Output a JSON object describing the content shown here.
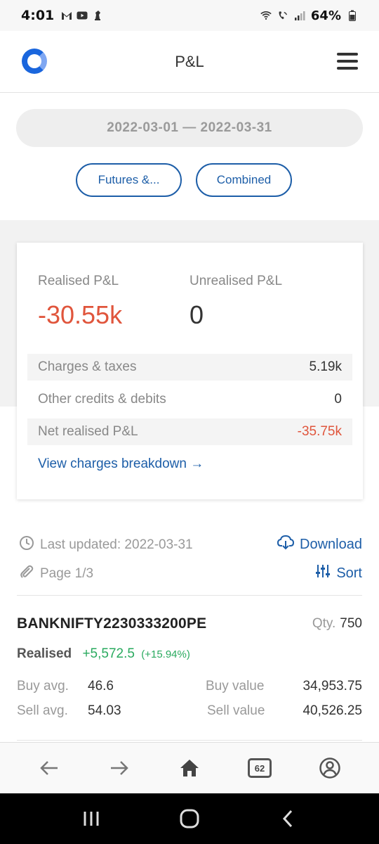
{
  "status_bar": {
    "time": "4:01",
    "battery": "64%",
    "left_icons": [
      "gmail-icon",
      "youtube-icon",
      "chess-icon"
    ],
    "right_icons": [
      "wifi-icon",
      "call-icon",
      "signal-icon",
      "battery-icon"
    ]
  },
  "header": {
    "title": "P&L"
  },
  "filters": {
    "date_range": "2022-03-01 — 2022-03-31",
    "segment": "Futures &...",
    "view": "Combined"
  },
  "summary": {
    "realised_label": "Realised P&L",
    "realised_value": "-30.55k",
    "unrealised_label": "Unrealised P&L",
    "unrealised_value": "0",
    "rows": [
      {
        "label": "Charges & taxes",
        "value": "5.19k"
      },
      {
        "label": "Other credits & debits",
        "value": "0"
      },
      {
        "label": "Net realised P&L",
        "value": "-35.75k"
      }
    ],
    "breakdown_link": "View charges breakdown →"
  },
  "meta": {
    "last_updated": "Last updated: 2022-03-31",
    "page": "Page 1/3",
    "download": "Download",
    "sort": "Sort"
  },
  "position": {
    "symbol": "BANKNIFTY2230333200PE",
    "qty_label": "Qty.",
    "qty": "750",
    "realised_label": "Realised",
    "realised_value": "+5,572.5",
    "realised_pct": "(+15.94%)",
    "buy_avg_label": "Buy avg.",
    "buy_avg": "46.6",
    "sell_avg_label": "Sell avg.",
    "sell_avg": "54.03",
    "buy_value_label": "Buy value",
    "buy_value": "34,953.75",
    "sell_value_label": "Sell value",
    "sell_value": "40,526.25"
  },
  "browser_nav": {
    "tab_count": "62"
  },
  "colors": {
    "accent": "#1d5ea8",
    "negative": "#e0553c",
    "positive": "#2aaa5f"
  }
}
